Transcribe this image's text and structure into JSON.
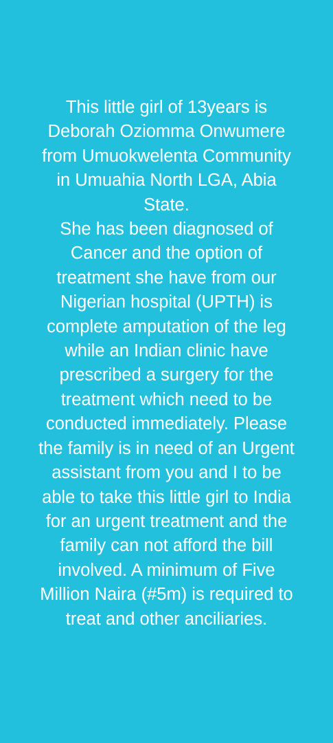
{
  "colors": {
    "background": "#23c0dd",
    "text": "#ffffff"
  },
  "status": {
    "lines": [
      "This little girl of 13years is",
      "Deborah Oziomma Onwumere",
      "from Umuokwelenta Community",
      "in Umuahia North LGA, Abia",
      "State.",
      "She has been diagnosed of",
      "Cancer and the option of",
      "treatment she have from our",
      "Nigerian hospital (UPTH) is",
      "complete amputation of the leg",
      "while an Indian clinic have",
      "prescribed a surgery for the",
      "treatment which need to be",
      "conducted immediately. Please",
      "the family is in need of an Urgent",
      "assistant from you and I to be",
      "able to take this little girl to India",
      "for an urgent treatment and the",
      "family can not afford the bill",
      "involved. A minimum of Five",
      "Million Naira (#5m) is required to",
      "treat and other anciliaries."
    ]
  }
}
